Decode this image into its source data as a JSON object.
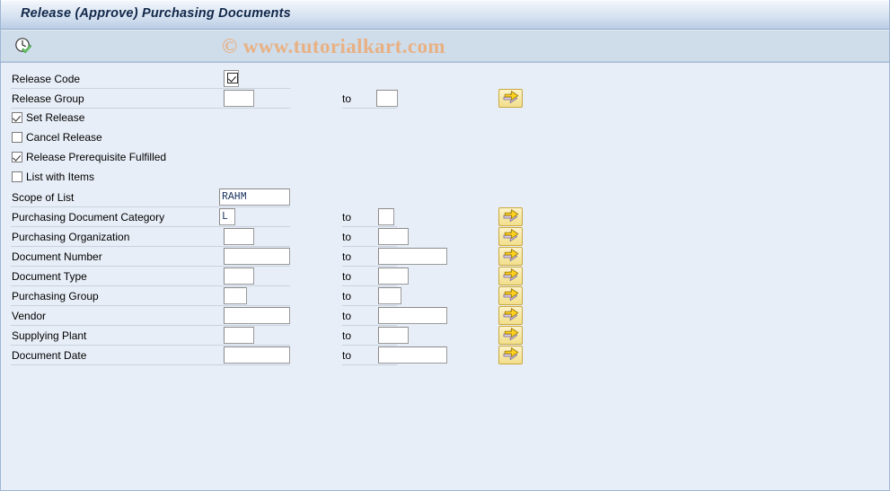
{
  "window": {
    "title": "Release (Approve) Purchasing Documents"
  },
  "toolbar": {
    "execute_button_name": "clock-check-icon",
    "execute_tooltip": "Execute"
  },
  "watermark": {
    "text": "© www.tutorialkart.com",
    "color": "#e8b184"
  },
  "colors": {
    "title_bar_gradient_top": "#f6f9fd",
    "title_bar_gradient_bottom": "#b9cde5",
    "toolbar_background": "#cfdcea",
    "page_background": "#e8eef7",
    "title_text": "#11284a",
    "field_text": "#17305c",
    "arrow_button_fill": "#f7e9a8",
    "arrow_button_border": "#c9a83e",
    "arrow_glyph": "#f5c518"
  },
  "form": {
    "to_label": "to",
    "fields": [
      {
        "label": "Release Code",
        "value": "",
        "kind": "checkbox-value",
        "has_to": false,
        "has_arrow": false
      },
      {
        "label": "Release Group",
        "value": "",
        "to_value": "",
        "kind": "text",
        "has_to": true,
        "has_arrow": true
      }
    ],
    "checkboxes": [
      {
        "label": "Set Release",
        "checked": true
      },
      {
        "label": "Cancel Release",
        "checked": false
      },
      {
        "label": "Release Prerequisite Fulfilled",
        "checked": true
      },
      {
        "label": "List with Items",
        "checked": false
      }
    ],
    "selection_fields": [
      {
        "label": "Scope of List",
        "value": "RAHM",
        "to_value": "",
        "has_to": false,
        "has_arrow": false
      },
      {
        "label": "Purchasing Document Category",
        "value": "L",
        "to_value": "",
        "has_to": true,
        "has_arrow": true
      },
      {
        "label": "Purchasing Organization",
        "value": "",
        "to_value": "",
        "has_to": true,
        "has_arrow": true
      },
      {
        "label": "Document Number",
        "value": "",
        "to_value": "",
        "has_to": true,
        "has_arrow": true
      },
      {
        "label": "Document Type",
        "value": "",
        "to_value": "",
        "has_to": true,
        "has_arrow": true
      },
      {
        "label": "Purchasing Group",
        "value": "",
        "to_value": "",
        "has_to": true,
        "has_arrow": true
      },
      {
        "label": "Vendor",
        "value": "",
        "to_value": "",
        "has_to": true,
        "has_arrow": true
      },
      {
        "label": "Supplying Plant",
        "value": "",
        "to_value": "",
        "has_to": true,
        "has_arrow": true
      },
      {
        "label": "Document Date",
        "value": "",
        "to_value": "",
        "has_to": true,
        "has_arrow": true
      }
    ]
  }
}
